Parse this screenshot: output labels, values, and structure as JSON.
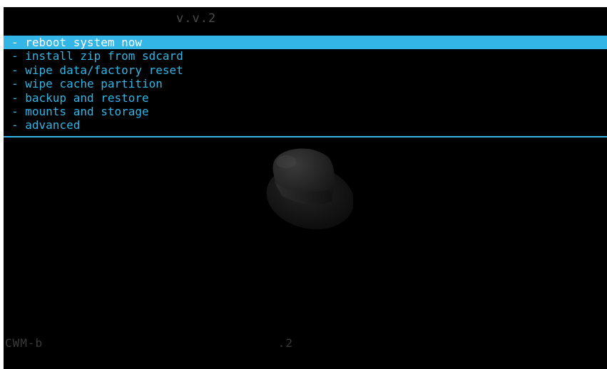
{
  "header": {
    "title": "v.v.2"
  },
  "menu": {
    "items": [
      {
        "label": "- reboot system now",
        "selected": true
      },
      {
        "label": "- install zip from sdcard",
        "selected": false
      },
      {
        "label": "- wipe data/factory reset",
        "selected": false
      },
      {
        "label": "- wipe cache partition",
        "selected": false
      },
      {
        "label": "- backup and restore",
        "selected": false
      },
      {
        "label": "- mounts and storage",
        "selected": false
      },
      {
        "label": "- advanced",
        "selected": false
      }
    ]
  },
  "logo": {
    "icon": "clockworkmod-hat-icon"
  },
  "status": {
    "text": "CWM-b                               .2"
  },
  "colors": {
    "accent": "#33b5e5",
    "background": "#000000",
    "selected_text": "#ffffff"
  }
}
